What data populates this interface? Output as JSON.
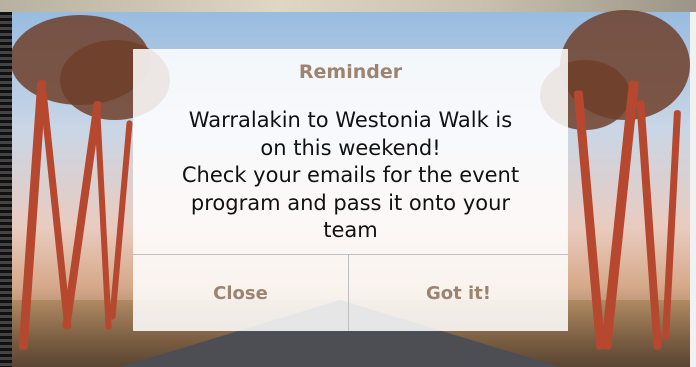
{
  "dialog": {
    "title": "Reminder",
    "message_lines": [
      "Warralakin to Westonia Walk is",
      "on this weekend!",
      "Check your emails for the event",
      "program and pass it onto your",
      "team"
    ],
    "buttons": {
      "close_label": "Close",
      "confirm_label": "Got it!"
    }
  },
  "colors": {
    "accent_text": "#9c8471",
    "message_text": "#111111",
    "overlay": "rgba(255,255,255,0.86)"
  }
}
